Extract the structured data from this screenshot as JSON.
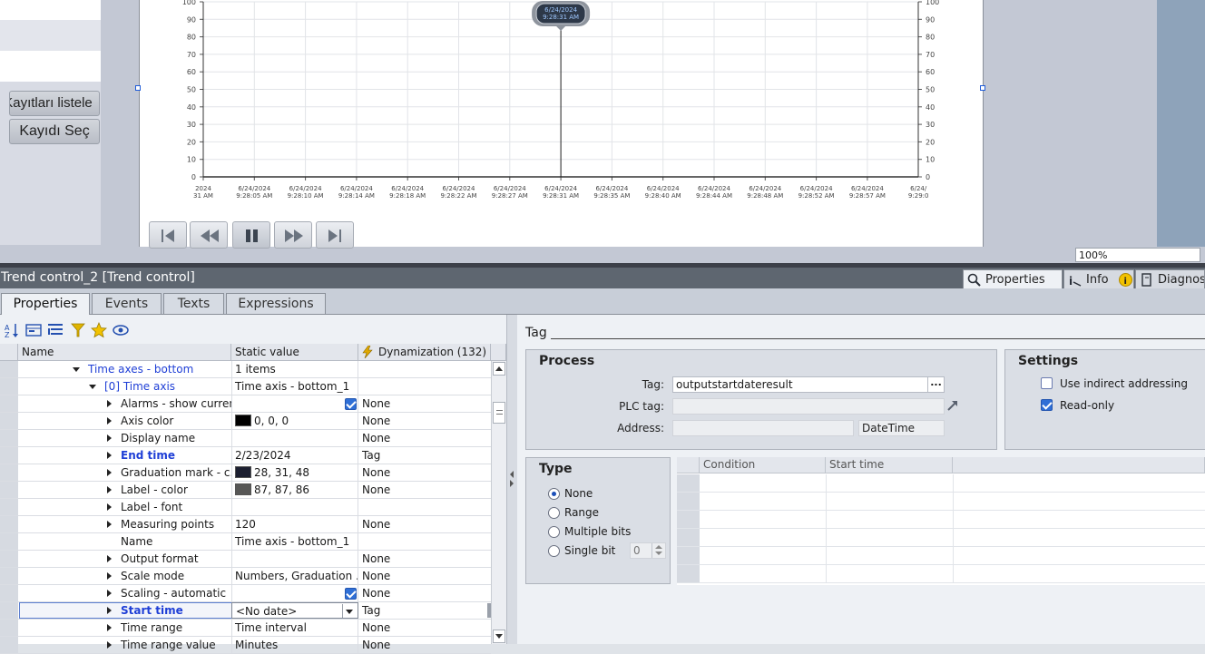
{
  "screen": {
    "buttons": {
      "list_records": "Kayıtları listele",
      "select_record": "Kayıdı Seç"
    },
    "zoom": "100%"
  },
  "trend": {
    "tooltip": {
      "date": "6/24/2024",
      "time": "9:28:31 AM"
    },
    "y_ticks": [
      "100",
      "90",
      "80",
      "70",
      "60",
      "50",
      "40",
      "30",
      "20",
      "10",
      "0"
    ],
    "x_ticks": [
      {
        "date": "2024",
        "time": "31 AM"
      },
      {
        "date": "6/24/2024",
        "time": "9:28:05 AM"
      },
      {
        "date": "6/24/2024",
        "time": "9:28:10 AM"
      },
      {
        "date": "6/24/2024",
        "time": "9:28:14 AM"
      },
      {
        "date": "6/24/2024",
        "time": "9:28:18 AM"
      },
      {
        "date": "6/24/2024",
        "time": "9:28:22 AM"
      },
      {
        "date": "6/24/2024",
        "time": "9:28:27 AM"
      },
      {
        "date": "6/24/2024",
        "time": "9:28:31 AM"
      },
      {
        "date": "6/24/2024",
        "time": "9:28:35 AM"
      },
      {
        "date": "6/24/2024",
        "time": "9:28:40 AM"
      },
      {
        "date": "6/24/2024",
        "time": "9:28:44 AM"
      },
      {
        "date": "6/24/2024",
        "time": "9:28:48 AM"
      },
      {
        "date": "6/24/2024",
        "time": "9:28:52 AM"
      },
      {
        "date": "6/24/2024",
        "time": "9:28:57 AM"
      },
      {
        "date": "6/24/",
        "time": "9:29:0"
      }
    ]
  },
  "inspector": {
    "title": "Trend control_2 [Trend control]",
    "right_tabs": {
      "properties": "Properties",
      "info": "Info",
      "diagnostics": "Diagnos"
    },
    "tabs": {
      "properties": "Properties",
      "events": "Events",
      "texts": "Texts",
      "expressions": "Expressions"
    },
    "grid": {
      "headers": {
        "name": "Name",
        "static": "Static value",
        "dyn": "Dynamization (132)"
      },
      "rows": [
        {
          "name": "Time axes - bottom",
          "value": "1 items",
          "dyn": ""
        },
        {
          "name": "[0] Time axis",
          "value": "Time axis - bottom_1",
          "dyn": ""
        },
        {
          "name": "Alarms - show current",
          "value": "",
          "dyn": "None"
        },
        {
          "name": "Axis color",
          "value": "0, 0, 0",
          "dyn": "None",
          "color": "#000000"
        },
        {
          "name": "Display name",
          "value": "",
          "dyn": "None"
        },
        {
          "name": "End time",
          "value": "2/23/2024",
          "dyn": "Tag"
        },
        {
          "name": "Graduation mark - c...",
          "value": "28, 31, 48",
          "dyn": "None",
          "color": "#1c1f30"
        },
        {
          "name": "Label - color",
          "value": "87, 87, 86",
          "dyn": "None",
          "color": "#575756"
        },
        {
          "name": "Label - font",
          "value": "",
          "dyn": ""
        },
        {
          "name": "Measuring points",
          "value": "120",
          "dyn": "None"
        },
        {
          "name": "Name",
          "value": "Time axis - bottom_1",
          "dyn": ""
        },
        {
          "name": "Output format",
          "value": "",
          "dyn": "None"
        },
        {
          "name": "Scale mode",
          "value": "Numbers, Graduation ...",
          "dyn": "None"
        },
        {
          "name": "Scaling - automatic",
          "value": "",
          "dyn": "None"
        },
        {
          "name": "Start time",
          "value": "<No date>",
          "dyn": "Tag"
        },
        {
          "name": "Time range",
          "value": "Time interval",
          "dyn": "None"
        },
        {
          "name": "Time range value",
          "value": "Minutes",
          "dyn": "None"
        }
      ]
    },
    "panel": {
      "title": "Tag",
      "process": {
        "title": "Process",
        "tag_label": "Tag:",
        "tag_value": "outputstartdateresult",
        "plc_label": "PLC tag:",
        "address_label": "Address:",
        "address_type": "DateTime"
      },
      "settings": {
        "title": "Settings",
        "indirect": "Use indirect addressing",
        "readonly": "Read-only"
      },
      "type": {
        "title": "Type",
        "none": "None",
        "range": "Range",
        "multiple": "Multiple bits",
        "single": "Single bit",
        "single_value": "0"
      },
      "table": {
        "condition": "Condition",
        "start_time": "Start time"
      }
    }
  }
}
